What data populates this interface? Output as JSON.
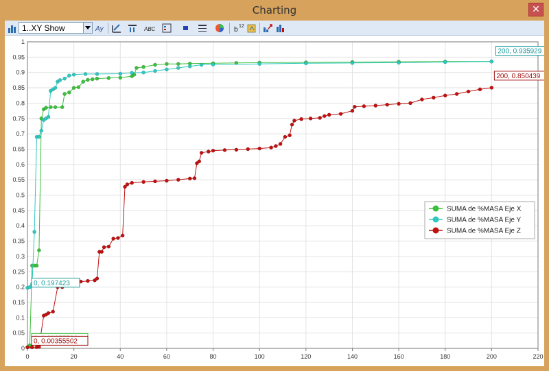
{
  "window": {
    "title": "Charting",
    "close_glyph": "✕"
  },
  "toolbar": {
    "chart_type_selector": {
      "selected": "1..XY Show"
    },
    "buttons": [
      {
        "name": "chart-type-icon"
      },
      {
        "name": "axis-tool-icon"
      },
      {
        "name": "edit-series-icon"
      },
      {
        "name": "series-options-icon"
      },
      {
        "name": "labels-abc-icon"
      },
      {
        "name": "legend-icon"
      },
      {
        "name": "marker-icon"
      },
      {
        "name": "line-style-icon"
      },
      {
        "name": "color-wheel-icon"
      },
      {
        "name": "superscript-icon"
      },
      {
        "name": "copy-chart-icon"
      },
      {
        "name": "export-icon"
      },
      {
        "name": "print-icon"
      }
    ]
  },
  "chart_data": {
    "type": "line",
    "xlim": [
      0,
      220
    ],
    "ylim": [
      0,
      1
    ],
    "x_ticks": [
      0,
      20,
      40,
      60,
      80,
      100,
      120,
      140,
      160,
      180,
      200,
      220
    ],
    "y_ticks": [
      0,
      0.05,
      0.1,
      0.15,
      0.2,
      0.25,
      0.3,
      0.35,
      0.4,
      0.45,
      0.5,
      0.55,
      0.6,
      0.65,
      0.7,
      0.75,
      0.8,
      0.85,
      0.9,
      0.95,
      1
    ],
    "grid": true,
    "legend_position": "right",
    "series": [
      {
        "name": "SUMA de %MASA Eje X",
        "color": "#3cbf3c",
        "points": [
          [
            0,
            0.0036
          ],
          [
            1,
            0.01
          ],
          [
            2,
            0.27
          ],
          [
            3,
            0.27
          ],
          [
            4,
            0.27
          ],
          [
            5,
            0.32
          ],
          [
            6,
            0.75
          ],
          [
            7,
            0.78
          ],
          [
            8,
            0.785
          ],
          [
            10,
            0.787
          ],
          [
            12,
            0.787
          ],
          [
            15,
            0.787
          ],
          [
            16,
            0.83
          ],
          [
            18,
            0.835
          ],
          [
            20,
            0.85
          ],
          [
            22,
            0.852
          ],
          [
            24,
            0.87
          ],
          [
            26,
            0.876
          ],
          [
            28,
            0.878
          ],
          [
            30,
            0.88
          ],
          [
            35,
            0.882
          ],
          [
            40,
            0.883
          ],
          [
            45,
            0.888
          ],
          [
            46,
            0.893
          ],
          [
            47,
            0.915
          ],
          [
            50,
            0.918
          ],
          [
            55,
            0.925
          ],
          [
            60,
            0.928
          ],
          [
            65,
            0.928
          ],
          [
            70,
            0.929
          ],
          [
            80,
            0.93
          ],
          [
            90,
            0.931
          ],
          [
            100,
            0.932
          ],
          [
            120,
            0.933
          ],
          [
            140,
            0.934
          ],
          [
            160,
            0.935
          ],
          [
            180,
            0.9355
          ],
          [
            200,
            0.935929
          ]
        ],
        "start_label": "0, 0.00355502",
        "end_label": "200, 0.935929"
      },
      {
        "name": "SUMA de %MASA Eje Y",
        "color": "#2ec8c0",
        "points": [
          [
            0,
            0.197423
          ],
          [
            1,
            0.2
          ],
          [
            2,
            0.21
          ],
          [
            3,
            0.38
          ],
          [
            4,
            0.69
          ],
          [
            5,
            0.69
          ],
          [
            6,
            0.71
          ],
          [
            7,
            0.745
          ],
          [
            8,
            0.75
          ],
          [
            9,
            0.755
          ],
          [
            10,
            0.84
          ],
          [
            11,
            0.845
          ],
          [
            12,
            0.85
          ],
          [
            13,
            0.87
          ],
          [
            14,
            0.875
          ],
          [
            16,
            0.88
          ],
          [
            18,
            0.89
          ],
          [
            20,
            0.893
          ],
          [
            25,
            0.895
          ],
          [
            30,
            0.895
          ],
          [
            40,
            0.896
          ],
          [
            45,
            0.899
          ],
          [
            50,
            0.9
          ],
          [
            55,
            0.905
          ],
          [
            60,
            0.91
          ],
          [
            65,
            0.915
          ],
          [
            70,
            0.92
          ],
          [
            75,
            0.925
          ],
          [
            80,
            0.926
          ],
          [
            100,
            0.928
          ],
          [
            120,
            0.93
          ],
          [
            140,
            0.931
          ],
          [
            160,
            0.932
          ],
          [
            180,
            0.934
          ],
          [
            200,
            0.935929
          ]
        ],
        "start_label": "0, 0.197423"
      },
      {
        "name": "SUMA de %MASA Eje Z",
        "color": "#c01010",
        "points": [
          [
            0,
            0.0036
          ],
          [
            2,
            0.0036
          ],
          [
            4,
            0.004
          ],
          [
            5,
            0.005
          ],
          [
            7,
            0.107
          ],
          [
            8,
            0.11
          ],
          [
            9,
            0.115
          ],
          [
            11,
            0.12
          ],
          [
            13,
            0.2
          ],
          [
            15,
            0.2
          ],
          [
            17,
            0.205
          ],
          [
            19,
            0.21
          ],
          [
            21,
            0.212
          ],
          [
            23,
            0.218
          ],
          [
            26,
            0.22
          ],
          [
            29,
            0.222
          ],
          [
            30,
            0.228
          ],
          [
            31,
            0.315
          ],
          [
            32,
            0.315
          ],
          [
            33,
            0.33
          ],
          [
            35,
            0.332
          ],
          [
            37,
            0.358
          ],
          [
            39,
            0.36
          ],
          [
            41,
            0.368
          ],
          [
            42,
            0.527
          ],
          [
            43,
            0.535
          ],
          [
            45,
            0.54
          ],
          [
            50,
            0.543
          ],
          [
            55,
            0.545
          ],
          [
            60,
            0.547
          ],
          [
            65,
            0.55
          ],
          [
            70,
            0.554
          ],
          [
            72,
            0.555
          ],
          [
            73,
            0.604
          ],
          [
            74,
            0.61
          ],
          [
            75,
            0.638
          ],
          [
            78,
            0.642
          ],
          [
            80,
            0.645
          ],
          [
            85,
            0.647
          ],
          [
            90,
            0.648
          ],
          [
            95,
            0.65
          ],
          [
            100,
            0.652
          ],
          [
            105,
            0.655
          ],
          [
            107,
            0.66
          ],
          [
            109,
            0.667
          ],
          [
            111,
            0.69
          ],
          [
            113,
            0.695
          ],
          [
            114,
            0.73
          ],
          [
            115,
            0.743
          ],
          [
            118,
            0.748
          ],
          [
            122,
            0.75
          ],
          [
            126,
            0.752
          ],
          [
            128,
            0.758
          ],
          [
            130,
            0.762
          ],
          [
            135,
            0.765
          ],
          [
            140,
            0.775
          ],
          [
            141,
            0.788
          ],
          [
            145,
            0.79
          ],
          [
            150,
            0.792
          ],
          [
            155,
            0.795
          ],
          [
            160,
            0.798
          ],
          [
            165,
            0.8
          ],
          [
            170,
            0.812
          ],
          [
            175,
            0.818
          ],
          [
            180,
            0.825
          ],
          [
            185,
            0.83
          ],
          [
            190,
            0.838
          ],
          [
            195,
            0.845
          ],
          [
            200,
            0.850439
          ]
        ],
        "end_label": "200, 0.850439"
      }
    ]
  }
}
